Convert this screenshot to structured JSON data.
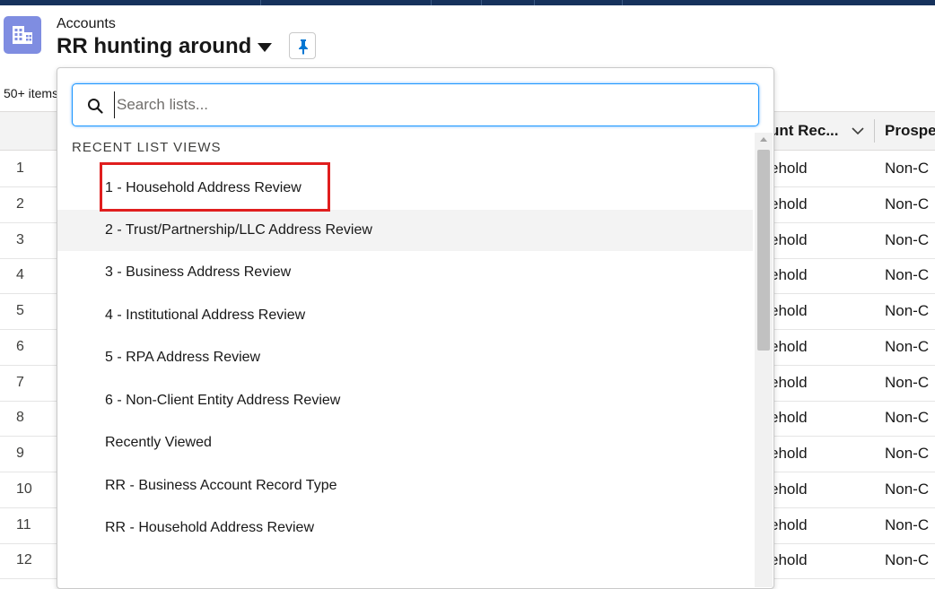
{
  "header": {
    "object_label": "Accounts",
    "list_title": "RR hunting around",
    "item_count": "50+ items"
  },
  "table": {
    "columns": [
      {
        "label": "unt Rec..."
      },
      {
        "label": "Prospect"
      }
    ],
    "rows": [
      {
        "num": "1",
        "c1": "ehold",
        "c2": "Non-C"
      },
      {
        "num": "2",
        "c1": "ehold",
        "c2": "Non-C"
      },
      {
        "num": "3",
        "c1": "ehold",
        "c2": "Non-C"
      },
      {
        "num": "4",
        "c1": "ehold",
        "c2": "Non-C"
      },
      {
        "num": "5",
        "c1": "ehold",
        "c2": "Non-C"
      },
      {
        "num": "6",
        "c1": "ehold",
        "c2": "Non-C"
      },
      {
        "num": "7",
        "c1": "ehold",
        "c2": "Non-C"
      },
      {
        "num": "8",
        "c1": "ehold",
        "c2": "Non-C"
      },
      {
        "num": "9",
        "c1": "ehold",
        "c2": "Non-C"
      },
      {
        "num": "10",
        "c1": "ehold",
        "c2": "Non-C"
      },
      {
        "num": "11",
        "c1": "ehold",
        "c2": "Non-C"
      },
      {
        "num": "12",
        "c1": "ehold",
        "c2": "Non-C"
      }
    ]
  },
  "dropdown": {
    "search_placeholder": "Search lists...",
    "section_heading": "RECENT LIST VIEWS",
    "items": [
      {
        "label": "1 - Household Address Review"
      },
      {
        "label": "2 - Trust/Partnership/LLC Address Review"
      },
      {
        "label": "3 - Business Address Review"
      },
      {
        "label": "4 - Institutional Address Review"
      },
      {
        "label": "5 - RPA Address Review"
      },
      {
        "label": "6 - Non-Client Entity Address Review"
      },
      {
        "label": "Recently Viewed"
      },
      {
        "label": "RR - Business Account Record Type"
      },
      {
        "label": "RR - Household Address Review"
      }
    ]
  },
  "icons": {
    "object": "accounts-building-icon",
    "caret": "caret-down-icon",
    "pin": "pin-icon",
    "search": "search-icon",
    "sort": "chevron-down-icon"
  },
  "colors": {
    "accent": "#1b96ff",
    "object_icon_bg": "#7f8de1",
    "highlight": "#e01e1e",
    "topbar": "#16325c"
  }
}
